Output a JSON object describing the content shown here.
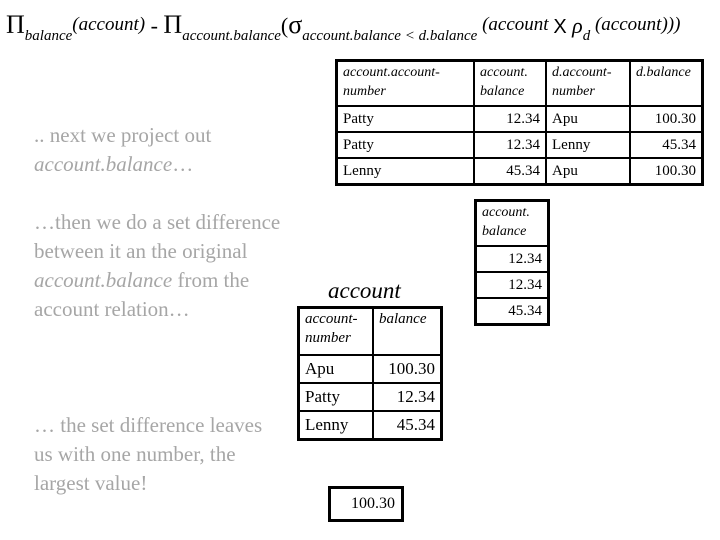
{
  "formula": {
    "pi1": "Π",
    "pi1_sub": "balance",
    "arg1": "(account)",
    "minus": " - ",
    "pi2": "Π",
    "pi2_sub": "account.balance",
    "open_paren": "(",
    "sigma": "σ",
    "sigma_sub": "account.balance < d.balance",
    "inner_open": " (account ",
    "cross": "X",
    "rho": " ρ",
    "rho_sub": "d",
    "inner_close": " (account)))"
  },
  "notes": {
    "note1_text": ".. next we project out ",
    "note1_italic": "account.balance",
    "note1_end": "…",
    "note2_text": "…then we do a set difference between it an the original ",
    "note2_italic": "account.balance",
    "note2_end": " from the account relation…",
    "note3_text": "… the set difference leaves us with one number, the largest value!"
  },
  "cross_table": {
    "headers": [
      "account.account-number",
      "account. balance",
      "d.account-number",
      "d.balance"
    ],
    "rows": [
      [
        "Patty",
        "12.34",
        "Apu",
        "100.30"
      ],
      [
        "Patty",
        "12.34",
        "Lenny",
        "45.34"
      ],
      [
        "Lenny",
        "45.34",
        "Apu",
        "100.30"
      ]
    ]
  },
  "projection_table": {
    "header": "account. balance",
    "rows": [
      "12.34",
      "12.34",
      "45.34"
    ]
  },
  "account_table": {
    "title": "account",
    "headers": [
      "account-number",
      "balance"
    ],
    "rows": [
      [
        "Apu",
        "100.30"
      ],
      [
        "Patty",
        "12.34"
      ],
      [
        "Lenny",
        "45.34"
      ]
    ]
  },
  "result": {
    "value": "100.30"
  }
}
